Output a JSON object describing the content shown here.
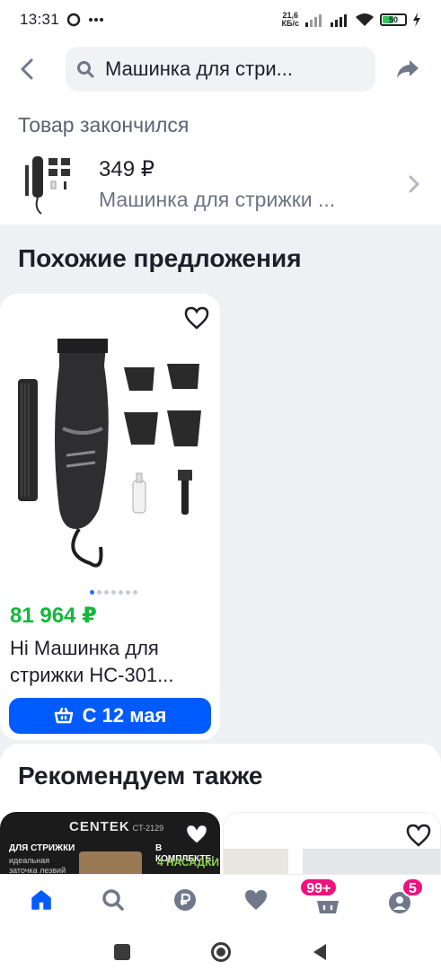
{
  "status_bar": {
    "time": "13:31",
    "net_speed_value": "21,6",
    "net_speed_unit": "КБ/с",
    "battery": "50",
    "battery_level": 0.5
  },
  "header": {
    "search_query": "Машинка для стри..."
  },
  "out_of_stock": {
    "title": "Товар закончился",
    "price": "349 ₽",
    "name": "Машинка для стрижки ..."
  },
  "similar": {
    "title": "Похожие предложения",
    "card": {
      "price": "81 964 ₽",
      "title": "Hi Машинка для стрижки HC-301...",
      "delivery": "С 12 мая",
      "carousel_count": 7,
      "carousel_active": 1
    }
  },
  "recommend": {
    "title": "Рекомендуем также",
    "promo": {
      "brand": "CENTEK",
      "model": "CT-2129",
      "left_line1": "ДЛЯ СТРИЖКИ",
      "left_line2": "идеальная",
      "left_line3": "заточка лезвий",
      "right_line1": "В КОМПЛЕКТЕ:",
      "right_line2": "4 НАСАДКИ"
    }
  },
  "bottom_nav": {
    "cart_badge": "99+",
    "profile_badge": "5"
  },
  "colors": {
    "accent": "#005bff",
    "price_green": "#13b83b",
    "badge_pink": "#f1117e"
  }
}
